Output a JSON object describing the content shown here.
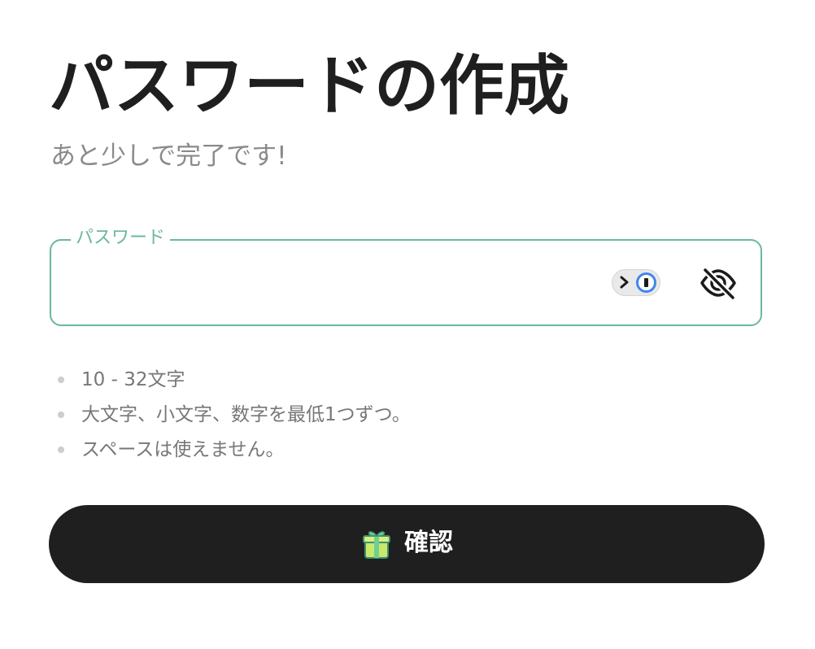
{
  "page": {
    "title": "パスワードの作成",
    "subtitle": "あと少しで完了です!"
  },
  "password_field": {
    "label": "パスワード",
    "value": "",
    "placeholder": "",
    "password_manager_icon": "password-manager-icon",
    "visibility_icon": "eye-off-icon"
  },
  "requirements": [
    "10 - 32文字",
    "大文字、小文字、数字を最低1つずつ。",
    "スペースは使えません。"
  ],
  "confirm_button": {
    "label": "確認",
    "icon": "gift-icon"
  },
  "colors": {
    "accent": "#6bb79f",
    "button_background": "#1f1f1f",
    "title": "#1f1f1f",
    "muted_text": "#777777",
    "password_manager_blue": "#3f86ee"
  }
}
